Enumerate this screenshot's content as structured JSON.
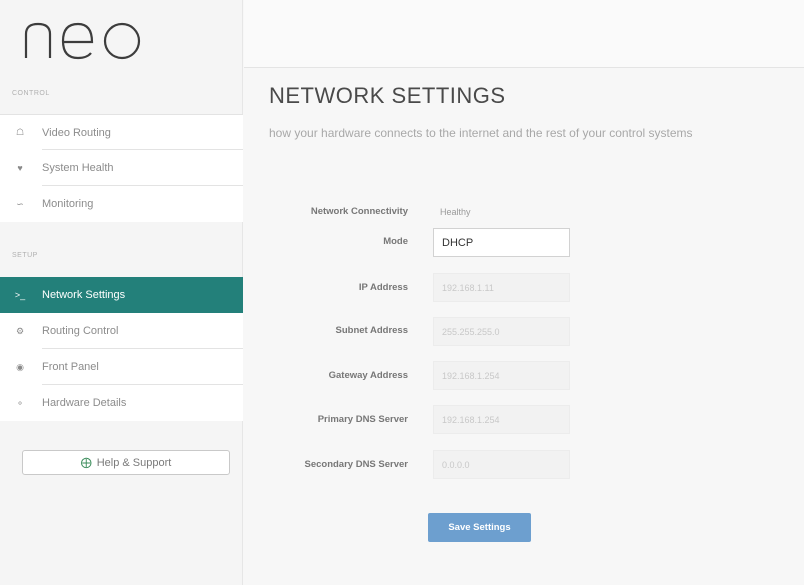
{
  "sidebar": {
    "logo_text": "neo",
    "sections": [
      {
        "label": "CONTROL"
      },
      {
        "label": "SETUP"
      }
    ],
    "items": [
      {
        "label": "Video Routing",
        "icon": "home-icon"
      },
      {
        "label": "System Health",
        "icon": "heart-icon"
      },
      {
        "label": "Monitoring",
        "icon": "signal-icon"
      },
      {
        "label": "Network Settings",
        "icon": "terminal-icon",
        "active": true
      },
      {
        "label": "Routing Control",
        "icon": "cogs-icon"
      },
      {
        "label": "Front Panel",
        "icon": "dot-circle-icon"
      },
      {
        "label": "Hardware Details",
        "icon": "ring-icon"
      }
    ],
    "help_label": "Help & Support"
  },
  "main": {
    "title": "NETWORK SETTINGS",
    "subtitle": "how your hardware connects to the internet and the rest of your control systems",
    "connectivity": {
      "label": "Network Connectivity",
      "value": "Healthy"
    },
    "mode": {
      "label": "Mode",
      "value": "DHCP"
    },
    "fields": [
      {
        "label": "IP Address",
        "value": "192.168.1.11"
      },
      {
        "label": "Subnet Address",
        "value": "255.255.255.0"
      },
      {
        "label": "Gateway Address",
        "value": "192.168.1.254"
      },
      {
        "label": "Primary DNS Server",
        "value": "192.168.1.254"
      },
      {
        "label": "Secondary DNS Server",
        "value": "0.0.0.0"
      }
    ],
    "save_label": "Save Settings"
  },
  "colors": {
    "accent": "#23807a",
    "button": "#6d9fcf",
    "help_icon": "#3a8c5a"
  }
}
